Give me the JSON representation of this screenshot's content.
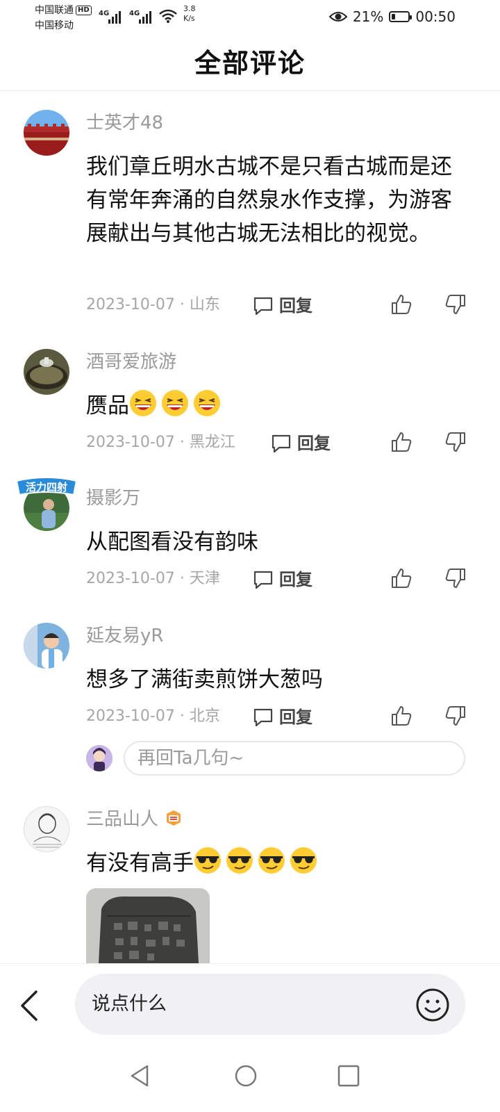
{
  "status_bar": {
    "carrier1": "中国联通",
    "hd": "HD",
    "carrier2": "中国移动",
    "net1": "4G",
    "net2": "4G",
    "speed_value": "3.8",
    "speed_unit": "K/s",
    "battery_percent": "21%",
    "battery_level": 0.21,
    "time": "00:50"
  },
  "header": {
    "title": "全部评论"
  },
  "comments": [
    {
      "username": "士英才48",
      "content": "我们章丘明水古城不是只看古城而是还有常年奔涌的自然泉水作支撑，为游客展献出与其他古城无法相比的视觉。",
      "date": "2023-10-07",
      "location": "山东",
      "reply_label": "回复"
    },
    {
      "username": "酒哥爱旅游",
      "content": "赝品",
      "emojis": [
        "grin-squint",
        "grin-squint",
        "grin-squint"
      ],
      "date": "2023-10-07",
      "location": "黑龙江",
      "reply_label": "回复"
    },
    {
      "username": "摄影万",
      "avatar_badge": "活力四射",
      "content": "从配图看没有韵味",
      "date": "2023-10-07",
      "location": "天津",
      "reply_label": "回复"
    },
    {
      "username": "延友易yR",
      "content": "想多了满街卖煎饼大葱吗",
      "date": "2023-10-07",
      "location": "北京",
      "reply_label": "回复"
    },
    {
      "username": "三品山人",
      "content": "有没有高手",
      "emojis": [
        "sunglasses",
        "sunglasses",
        "sunglasses",
        "sunglasses"
      ],
      "image": "stone-seal-photo"
    }
  ],
  "reply_prompt": {
    "placeholder": "再回Ta几句~"
  },
  "bottom_bar": {
    "input_placeholder": "说点什么"
  },
  "colors": {
    "accent": "#1a73e8",
    "muted_text": "#9a9a9a",
    "input_bg": "#f1f1f4"
  }
}
